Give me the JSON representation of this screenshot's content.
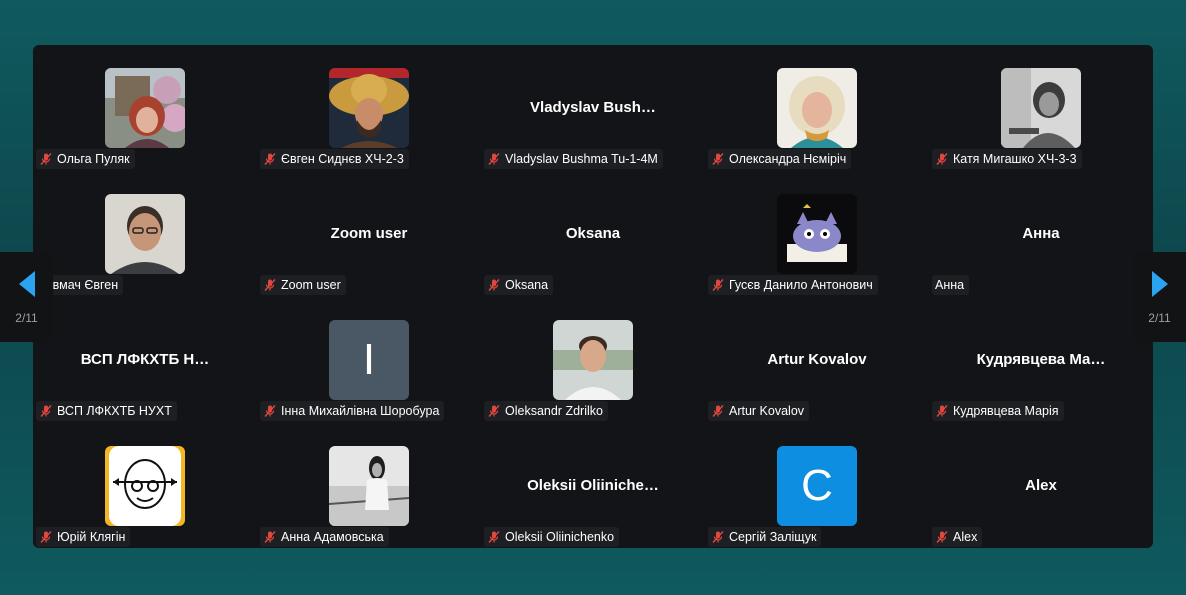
{
  "pager": {
    "left_label": "2/11",
    "right_label": "2/11"
  },
  "tiles": [
    {
      "name": "Ольга Пуляк",
      "display": "",
      "type": "photo",
      "avatar": "woman-flowers"
    },
    {
      "name": "Євген Сиднєв ХЧ-2-3",
      "display": "",
      "type": "photo",
      "avatar": "man-straw-hat"
    },
    {
      "name": "Vladyslav Bushma Tu-1-4M",
      "display": "Vladyslav  Bush…",
      "type": "text"
    },
    {
      "name": "Олександра Нєміріч",
      "display": "",
      "type": "photo",
      "avatar": "woman-blonde"
    },
    {
      "name": "Катя Мигашко ХЧ-3-3",
      "display": "",
      "type": "photo",
      "avatar": "girl-bw"
    },
    {
      "name": "Товмач Євген",
      "display": "",
      "type": "photo",
      "avatar": "man-glasses",
      "noMic": true
    },
    {
      "name": "Zoom user",
      "display": "Zoom user",
      "type": "text"
    },
    {
      "name": "Oksana",
      "display": "Oksana",
      "type": "text"
    },
    {
      "name": "Гусєв Данило Антонович",
      "display": "",
      "type": "photo",
      "avatar": "cartoon-cat"
    },
    {
      "name": "Анна",
      "display": "Анна",
      "type": "text",
      "noMic": true
    },
    {
      "name": "ВСП ЛФКХТБ НУХТ",
      "display": "ВСП ЛФКХТБ  Н…",
      "type": "text"
    },
    {
      "name": "Інна Михайлівна Шоробура",
      "display": "",
      "type": "letter",
      "letter": "I",
      "color": "#4a5866"
    },
    {
      "name": "Oleksandr Zdrilko",
      "display": "",
      "type": "photo",
      "avatar": "man-smile"
    },
    {
      "name": "Artur Kovalov",
      "display": "Artur Kovalov",
      "type": "text"
    },
    {
      "name": "Кудрявцева Марія",
      "display": "Кудрявцева  Ма…",
      "type": "text"
    },
    {
      "name": "Юрій Клягін",
      "display": "",
      "type": "photo",
      "avatar": "bald-illustration"
    },
    {
      "name": "Анна Адамовська",
      "display": "",
      "type": "photo",
      "avatar": "woman-balcony-bw"
    },
    {
      "name": "Oleksii Oliinichenko",
      "display": "Oleksii  Oliiniche…",
      "type": "text"
    },
    {
      "name": "Сергій Заліщук",
      "display": "",
      "type": "letter",
      "letter": "C",
      "color": "#0e8ee0"
    },
    {
      "name": "Alex",
      "display": "Alex",
      "type": "text"
    }
  ]
}
